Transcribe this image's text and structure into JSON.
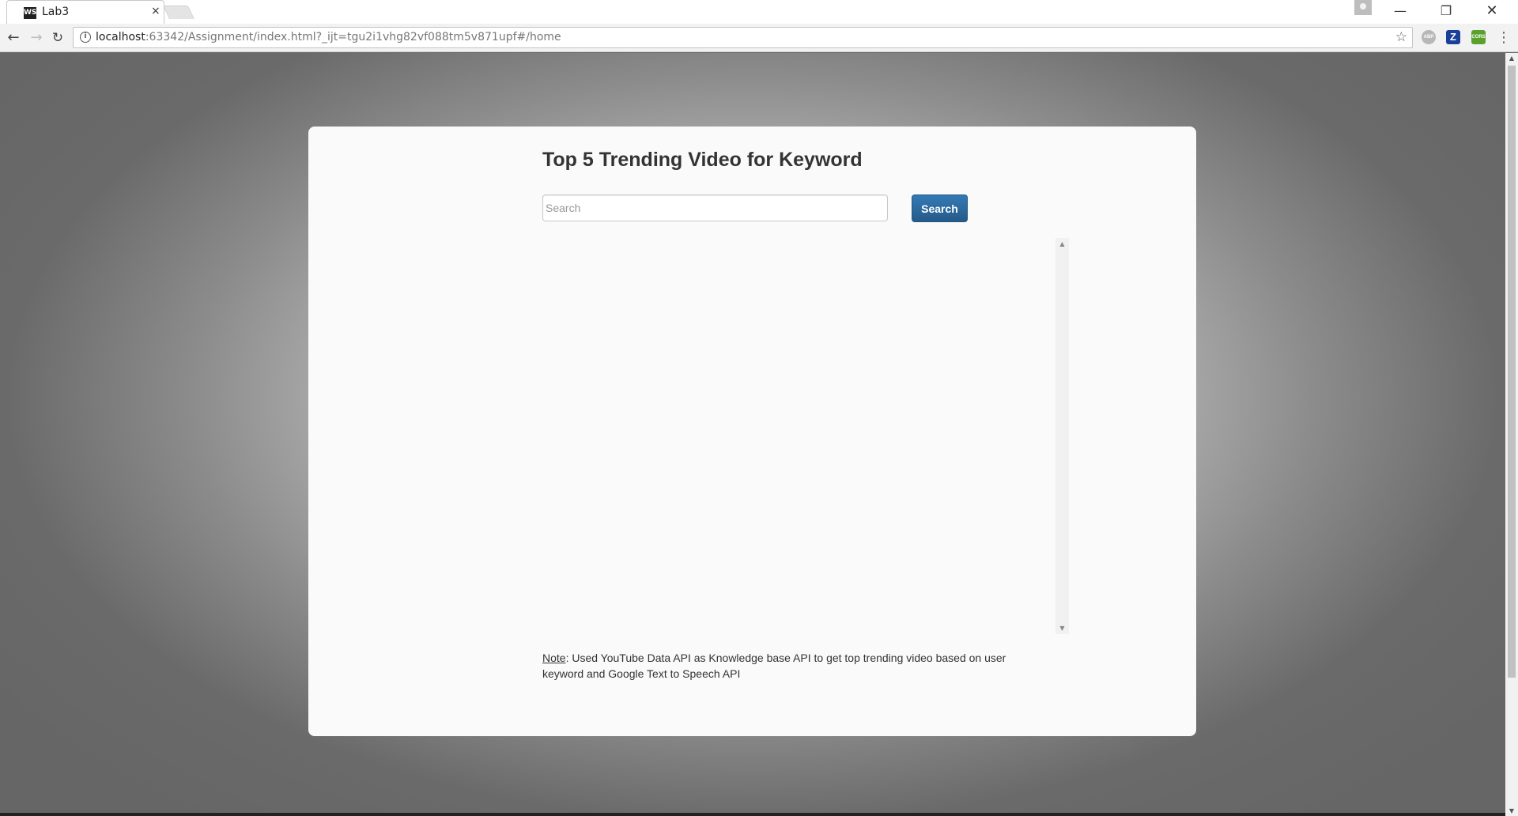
{
  "browser": {
    "tab_title": "Lab3",
    "tab_favicon_text": "WS",
    "tab_close": "×",
    "window_controls": {
      "minimize": "—",
      "maximize": "❐",
      "close": "✕"
    },
    "nav": {
      "back": "←",
      "forward": "→",
      "reload": "↻"
    },
    "url_host": "localhost",
    "url_rest": ":63342/Assignment/index.html?_ijt=tgu2i1vhg82vf088tm5v871upf#/home",
    "extensions": {
      "abp": "ABP",
      "zotero": "Z",
      "cors": "CORS"
    },
    "star": "☆",
    "menu": "⋮"
  },
  "page": {
    "title": "Top 5 Trending Video for Keyword",
    "search": {
      "placeholder": "Search",
      "value": "",
      "button_label": "Search"
    },
    "note": {
      "label": "Note",
      "text": ": Used YouTube Data API as Knowledge base API to get top trending video based on user keyword and Google Text to Speech API"
    }
  },
  "colors": {
    "button_blue": "#337ab7",
    "card_background": "#fafafa",
    "page_background": "#6a6a6a"
  }
}
